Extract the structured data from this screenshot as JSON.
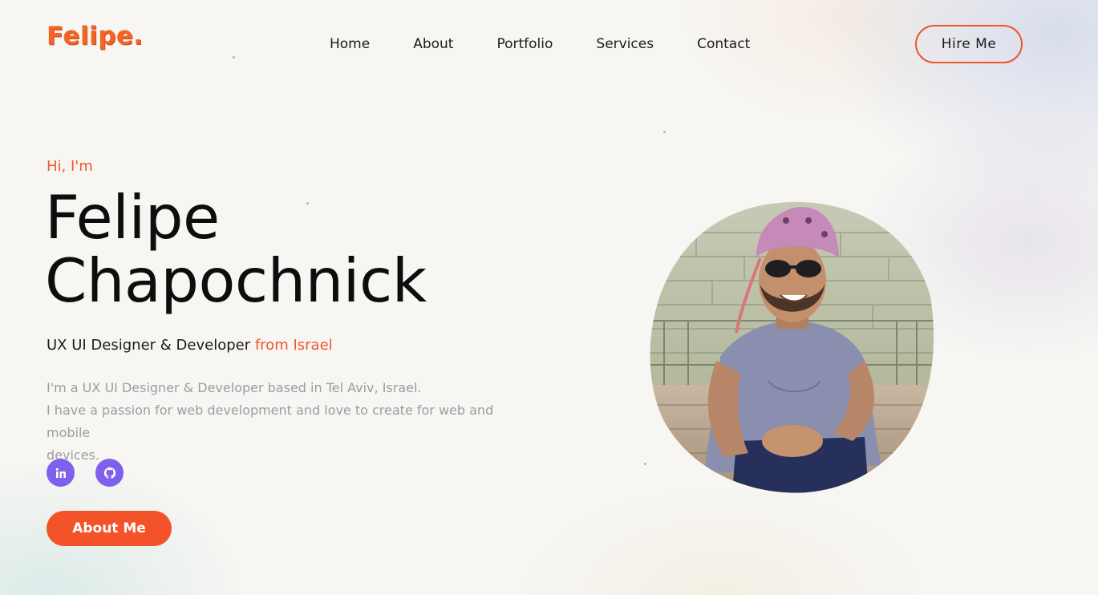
{
  "header": {
    "logo_text": "Felipe.",
    "nav": [
      {
        "label": "Home"
      },
      {
        "label": "About"
      },
      {
        "label": "Portfolio"
      },
      {
        "label": "Services"
      },
      {
        "label": "Contact"
      }
    ],
    "hire_label": "Hire Me"
  },
  "hero": {
    "greeting": "Hi, I'm",
    "name_line1": "Felipe",
    "name_line2": "Chapochnick",
    "role_prefix": "UX UI Designer & Developer",
    "role_accent": "from Israel",
    "bio_line1": "I'm a UX UI Designer & Developer based in Tel Aviv, Israel.",
    "bio_line2": "I have a passion for web development and love to create for web and mobile",
    "bio_line3": "devices.",
    "socials": [
      {
        "icon": "linkedin-icon"
      },
      {
        "icon": "github-icon"
      }
    ],
    "cta_label": "About Me"
  },
  "colors": {
    "accent": "#f0542a",
    "social": "#7f60ec",
    "background": "#f7f6f3"
  }
}
